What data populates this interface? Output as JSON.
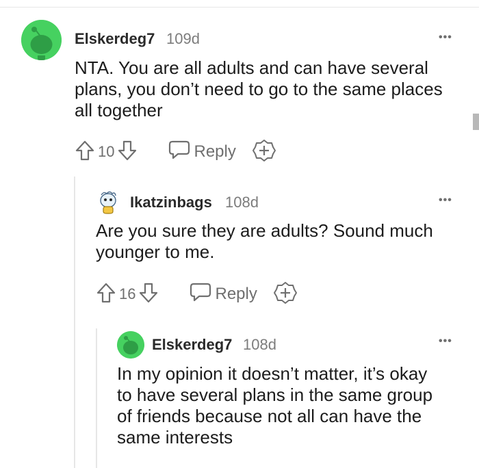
{
  "comments": [
    {
      "username": "Elskerdeg7",
      "age": "109d",
      "lines": [
        "NTA. You are all adults and can have several",
        "plans, you don’t need to go to the same places",
        "all together"
      ],
      "score": "10",
      "reply_label": "Reply",
      "avatar_color": "#46d160"
    },
    {
      "username": "Ikatzinbags",
      "age": "108d",
      "lines": [
        "Are you sure they are adults? Sound much",
        "younger to me."
      ],
      "score": "16",
      "reply_label": "Reply"
    },
    {
      "username": "Elskerdeg7",
      "age": "108d",
      "lines": [
        "In my opinion it doesn’t matter, it’s okay",
        "to have several plans in the same group",
        "of friends because not all can have the",
        "same interests"
      ],
      "avatar_color": "#46d160"
    }
  ],
  "icons": {
    "upvote": "arrow-up-icon",
    "downvote": "arrow-down-icon",
    "reply": "speech-bubble-icon",
    "award": "award-plus-icon",
    "more": "more-dots-icon"
  },
  "more_glyph": "•••"
}
